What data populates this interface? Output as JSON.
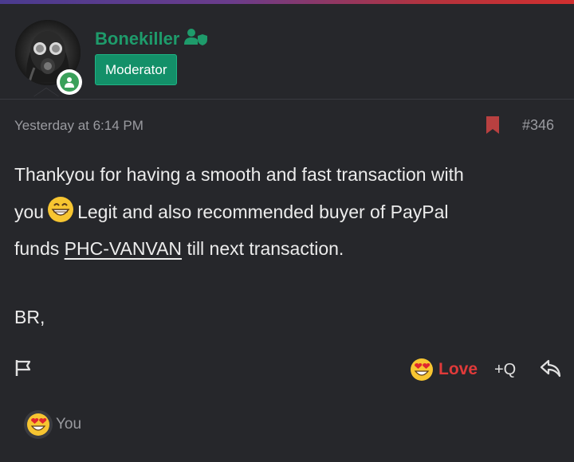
{
  "colors": {
    "background": "#26272b",
    "username": "#1e9b6b",
    "badge": "#139069",
    "love": "#e03a3a",
    "muted": "#9a9ba0"
  },
  "user": {
    "name": "Bonekiller",
    "role": "Moderator",
    "avatar_icon": "gas-mask-avatar",
    "status_icon": "online-user-icon",
    "name_icon": "user-shield-icon"
  },
  "post": {
    "date": "Yesterday at 6:14 PM",
    "number": "#346",
    "bookmark_icon": "bookmark-icon",
    "message": {
      "line1": "Thankyou for having a smooth and fast transaction with",
      "line2_before": "you",
      "line2_emoji": "grinning-face-emoji",
      "line2_after": "Legit and also recommended buyer of PayPal",
      "line3_before": "funds",
      "line3_link": "PHC-VANVAN",
      "line3_after": "till next transaction.",
      "signoff": "BR,"
    }
  },
  "actions": {
    "report_icon": "flag-icon",
    "love_label": "Love",
    "love_icon": "heart-eyes-emoji",
    "quote_label": "+Q",
    "reply_icon": "reply-icon"
  },
  "reactions": {
    "icon": "heart-eyes-emoji",
    "by": "You"
  }
}
